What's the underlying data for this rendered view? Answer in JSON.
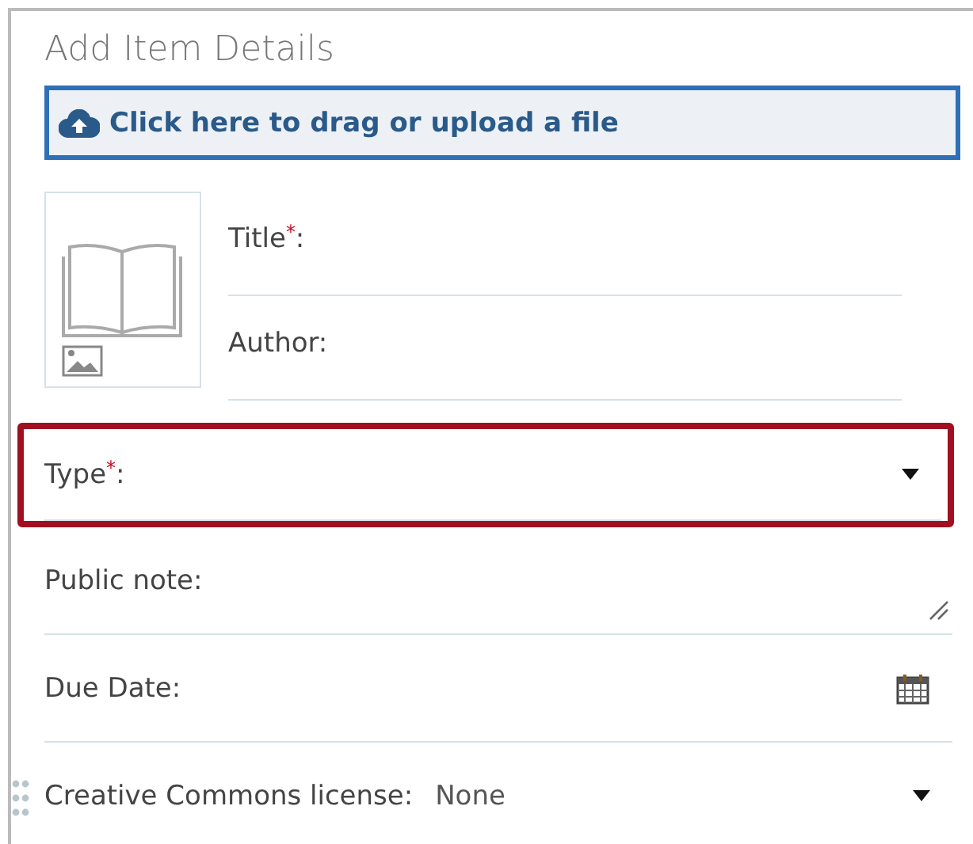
{
  "heading": "Add Item Details",
  "upload_button": {
    "label": "Click here to drag or upload a file"
  },
  "cover_fields": [
    {
      "label": "Title$^{*}$:"
    },
    {
      "label": "Author:"
    }
  ],
  "fields": [
    {
      "kind": "select",
      "label": "Type$^{*}$:",
      "highlighted": true,
      "draggable": false
    },
    {
      "kind": "textarea",
      "label": "Public note:",
      "highlighted": false,
      "draggable": false
    },
    {
      "kind": "date",
      "label": "Due Date:",
      "highlighted": false,
      "draggable": false
    },
    {
      "kind": "select",
      "label": "Creative Commons license:",
      "value": "None",
      "highlighted": false,
      "draggable": true
    }
  ]
}
